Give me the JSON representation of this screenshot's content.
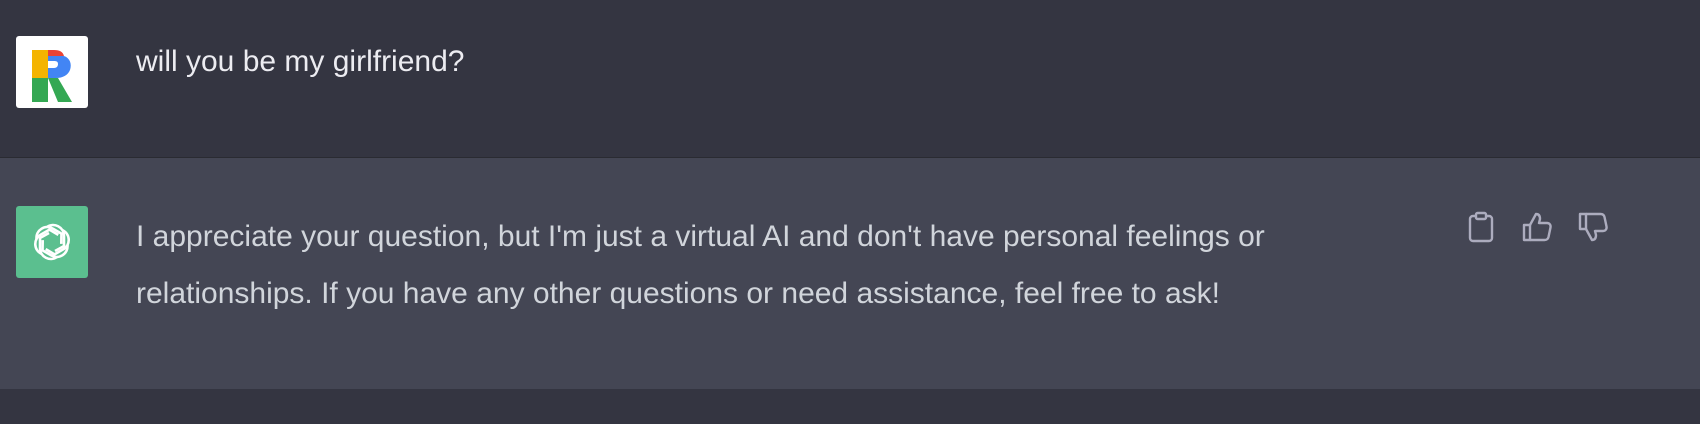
{
  "conversation": {
    "user_message": {
      "avatar_icon": "r-logo-icon",
      "text": "will you be my girlfriend?"
    },
    "assistant_message": {
      "avatar_icon": "openai-logo-icon",
      "text": "I appreciate your question, but I'm just a virtual AI and don't have personal feelings or relationships. If you have any other questions or need assistance, feel free to ask!",
      "actions": {
        "copy_icon": "clipboard-icon",
        "like_icon": "thumbs-up-icon",
        "dislike_icon": "thumbs-down-icon"
      }
    }
  },
  "colors": {
    "user_bg": "#343541",
    "assistant_bg": "#444654",
    "bot_avatar": "#5bbf8f"
  }
}
